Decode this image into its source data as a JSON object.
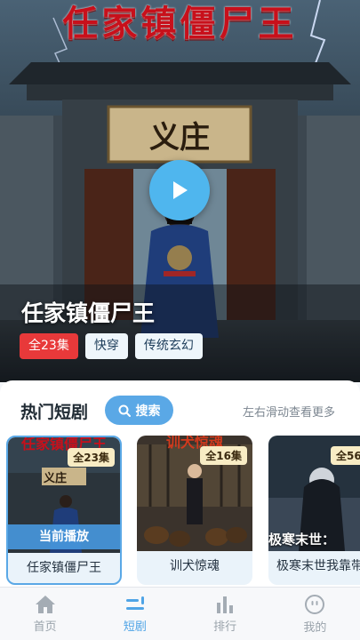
{
  "hero": {
    "art_title": "任家镇僵尸王",
    "gate_plaque": "义庄",
    "name": "任家镇僵尸王",
    "tags": [
      "全23集",
      "快穿",
      "传统玄幻"
    ]
  },
  "section": {
    "title": "热门短剧",
    "search_label": "搜索",
    "swipe_hint": "左右滑动查看更多"
  },
  "cards": [
    {
      "title": "任家镇僵尸王",
      "badge": "全23集",
      "overlay": "当前播放",
      "art_text": "任家镇僵尸王"
    },
    {
      "title": "训犬惊魂",
      "badge": "全16集",
      "art_text": "训犬惊魂"
    },
    {
      "title": "极寒末世我靠带",
      "badge": "全56",
      "art_text": "极寒末世："
    }
  ],
  "nav": [
    {
      "label": "首页",
      "icon": "home-icon"
    },
    {
      "label": "短剧",
      "icon": "drama-icon",
      "active": true
    },
    {
      "label": "排行",
      "icon": "chart-icon"
    },
    {
      "label": "我的",
      "icon": "profile-icon"
    }
  ],
  "colors": {
    "accent": "#4fb6ee",
    "tag_red": "#e8393a",
    "nav_active": "#4fa4e6"
  }
}
